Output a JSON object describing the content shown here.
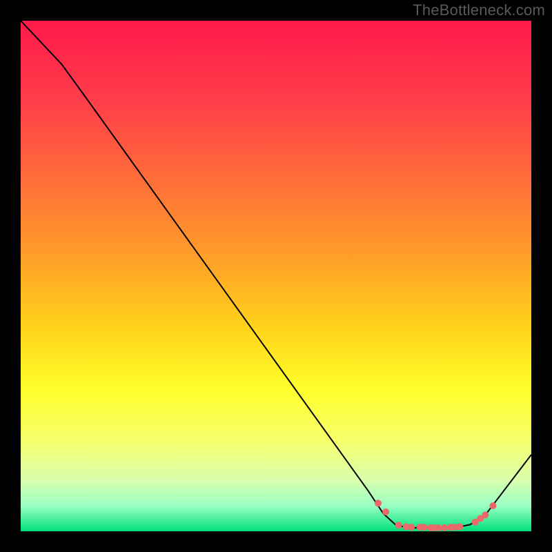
{
  "watermark": "TheBottleneck.com",
  "chart_data": {
    "type": "line",
    "title": "",
    "xlabel": "",
    "ylabel": "",
    "xlim": [
      0,
      100
    ],
    "ylim": [
      0,
      100
    ],
    "grid": false,
    "legend": false,
    "gradient_stops": [
      {
        "offset": 0.0,
        "color": "#ff1a4b"
      },
      {
        "offset": 0.15,
        "color": "#ff3b4a"
      },
      {
        "offset": 0.3,
        "color": "#ff6a3a"
      },
      {
        "offset": 0.45,
        "color": "#ff9a2a"
      },
      {
        "offset": 0.6,
        "color": "#ffd21a"
      },
      {
        "offset": 0.72,
        "color": "#ffff2a"
      },
      {
        "offset": 0.82,
        "color": "#f6ff6a"
      },
      {
        "offset": 0.9,
        "color": "#d8ffad"
      },
      {
        "offset": 0.95,
        "color": "#9affc4"
      },
      {
        "offset": 1.0,
        "color": "#00e07a"
      }
    ],
    "series": [
      {
        "name": "bottleneck-curve",
        "color": "#000000",
        "stroke_width": 2,
        "points": [
          {
            "x": 0.0,
            "y": 100.0
          },
          {
            "x": 8.0,
            "y": 91.5
          },
          {
            "x": 12.0,
            "y": 86.0
          },
          {
            "x": 68.0,
            "y": 8.0
          },
          {
            "x": 71.0,
            "y": 3.5
          },
          {
            "x": 73.5,
            "y": 1.2
          },
          {
            "x": 76.0,
            "y": 0.7
          },
          {
            "x": 85.0,
            "y": 0.7
          },
          {
            "x": 88.0,
            "y": 1.3
          },
          {
            "x": 91.0,
            "y": 3.2
          },
          {
            "x": 100.0,
            "y": 15.0
          }
        ]
      }
    ],
    "markers": {
      "name": "highlight-dots",
      "color": "#e86a6a",
      "radius": 5,
      "points": [
        {
          "x": 70.0,
          "y": 5.5
        },
        {
          "x": 71.5,
          "y": 3.8
        },
        {
          "x": 74.0,
          "y": 1.2
        },
        {
          "x": 75.5,
          "y": 0.9
        },
        {
          "x": 76.5,
          "y": 0.8
        },
        {
          "x": 78.2,
          "y": 0.8
        },
        {
          "x": 79.0,
          "y": 0.8
        },
        {
          "x": 80.3,
          "y": 0.7
        },
        {
          "x": 81.0,
          "y": 0.7
        },
        {
          "x": 81.8,
          "y": 0.7
        },
        {
          "x": 83.0,
          "y": 0.7
        },
        {
          "x": 84.2,
          "y": 0.8
        },
        {
          "x": 85.0,
          "y": 0.8
        },
        {
          "x": 86.0,
          "y": 0.9
        },
        {
          "x": 89.0,
          "y": 1.8
        },
        {
          "x": 90.0,
          "y": 2.5
        },
        {
          "x": 91.0,
          "y": 3.2
        },
        {
          "x": 92.5,
          "y": 5.0
        }
      ]
    }
  }
}
